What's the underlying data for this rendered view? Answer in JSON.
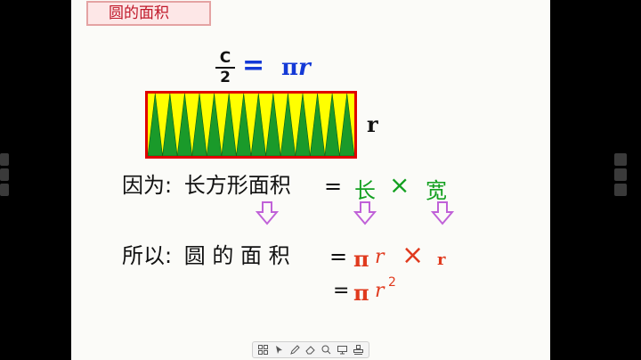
{
  "slide": {
    "title": "圆的面积",
    "top_formula": {
      "numerator": "C",
      "denominator": "2",
      "equals": "=",
      "pi": "π",
      "r": "r"
    },
    "side_label": "r",
    "line1": {
      "prefix": "因为:",
      "subject": "长方形面积",
      "equals": "=",
      "length": "长",
      "times": "×",
      "width": "宽"
    },
    "line2": {
      "prefix": "所以:",
      "subject": "圆 的 面 积",
      "equals": "=",
      "pi": "π",
      "r": "r",
      "times": "×",
      "r2": "r"
    },
    "line3": {
      "equals": "=",
      "pi": "π",
      "r": "r",
      "exponent": "2"
    }
  },
  "colors": {
    "title_red": "#c0182a",
    "formula_blue": "#1339d6",
    "green": "#13a020",
    "red": "#e03a1e",
    "arrow_purple": "#c061d8",
    "rect_yellow": "#ffff00",
    "rect_green": "#1a9a2a",
    "rect_border": "#e00000"
  },
  "toolbar": {
    "icons": [
      "grid-icon",
      "pointer-icon",
      "pen-icon",
      "eraser-icon",
      "zoom-icon",
      "screen-icon",
      "stamp-icon"
    ]
  }
}
